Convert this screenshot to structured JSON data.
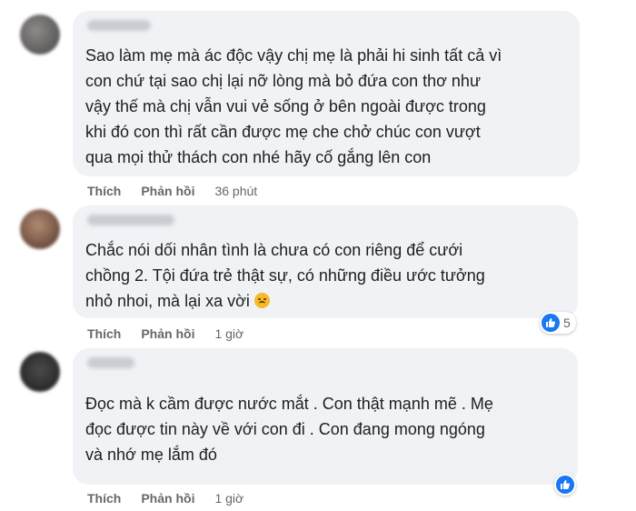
{
  "comments": [
    {
      "text": "Sao làm mẹ mà ác độc vậy chị mẹ là phải hi sinh tất cả vì\ncon chứ tại sao chị lại nỡ lòng mà bỏ đứa con thơ như\nvậy thế mà chị vẫn vui vẻ sống ở bên ngoài được trong\nkhi đó con thì rất cần được mẹ che chở chúc con vượt\nqua mọi thử thách con nhé hãy cố gắng lên con",
      "like_label": "Thích",
      "reply_label": "Phản hồi",
      "time": "36 phút"
    },
    {
      "text_before_emoji": "Chắc nói dối nhân tình là chưa có con riêng để cưới\nchồng 2. Tội đứa trẻ thật sự, có những điều ước tưởng\nnhỏ nhoi, mà lại xa vời ",
      "emoji": "sad-face",
      "like_label": "Thích",
      "reply_label": "Phản hồi",
      "time": "1 giờ",
      "reaction_count": "5"
    },
    {
      "text": "Đọc mà k cầm được nước mắt . Con thật mạnh mẽ . Mẹ\nđọc được tin này về với con đi . Con đang mong ngóng\nvà nhớ mẹ lắm đó",
      "like_label": "Thích",
      "reply_label": "Phản hồi",
      "time": "1 giờ"
    }
  ],
  "colors": {
    "bubble": "#f0f2f5",
    "like_blue": "#1877f2",
    "meta_gray": "#65676b"
  }
}
